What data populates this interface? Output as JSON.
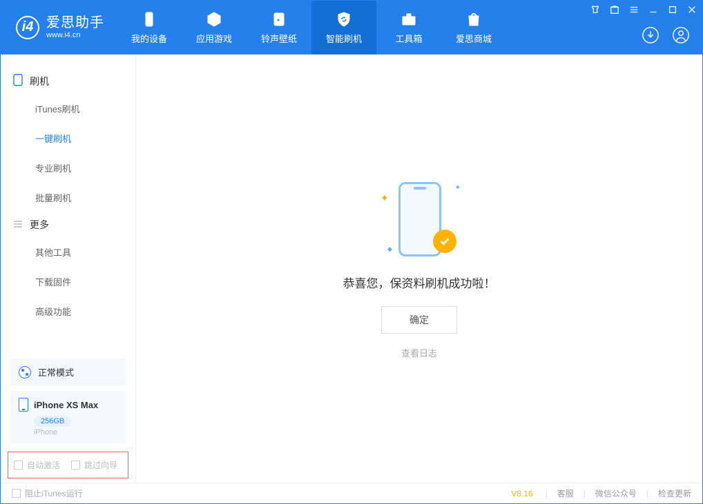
{
  "brand": {
    "main": "爱思助手",
    "sub": "www.i4.cn"
  },
  "tabs": {
    "t0": "我的设备",
    "t1": "应用游戏",
    "t2": "铃声壁纸",
    "t3": "智能刷机",
    "t4": "工具箱",
    "t5": "爱思商城"
  },
  "sidebar": {
    "section1": "刷机",
    "s1_items": {
      "i0": "iTunes刷机",
      "i1": "一键刷机",
      "i2": "专业刷机",
      "i3": "批量刷机"
    },
    "section2": "更多",
    "s2_items": {
      "i0": "其他工具",
      "i1": "下载固件",
      "i2": "高级功能"
    },
    "mode": "正常模式",
    "device": {
      "name": "iPhone XS Max",
      "storage": "256GB",
      "sub": "iPhone"
    },
    "cb1": "自动激活",
    "cb2": "跳过向导"
  },
  "main": {
    "success_msg": "恭喜您，保资料刷机成功啦！",
    "ok_btn": "确定",
    "log_link": "查看日志"
  },
  "footer": {
    "block_itunes": "阻止iTunes运行",
    "version": "V8.16",
    "link1": "客服",
    "link2": "微信公众号",
    "link3": "检查更新"
  }
}
